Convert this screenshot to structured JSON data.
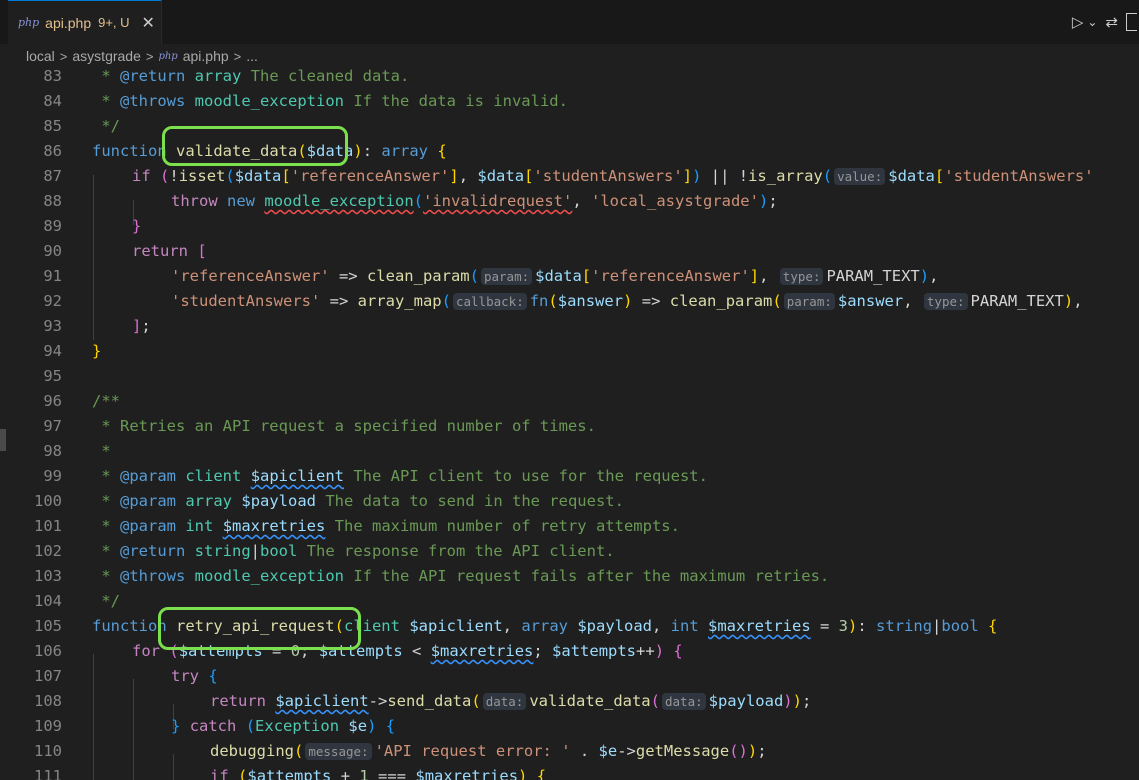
{
  "tab": {
    "lang_icon": "php",
    "filename": "api.php",
    "status": "9+, U",
    "close_glyph": "✕"
  },
  "actions": [
    {
      "name": "run-icon",
      "glyph": "▷"
    },
    {
      "name": "chevron-down-icon",
      "glyph": "⌄"
    },
    {
      "name": "source-control-compare-icon",
      "glyph": "⇄"
    }
  ],
  "breadcrumb": {
    "items": [
      "local",
      "asystgrade",
      "api.php",
      "..."
    ],
    "separator": ">",
    "php_icon": "php"
  },
  "editor": {
    "lines": [
      {
        "n": "83"
      },
      {
        "n": "84"
      },
      {
        "n": "85"
      },
      {
        "n": "86"
      },
      {
        "n": "87"
      },
      {
        "n": "88"
      },
      {
        "n": "89"
      },
      {
        "n": "90"
      },
      {
        "n": "91"
      },
      {
        "n": "92"
      },
      {
        "n": "93"
      },
      {
        "n": "94"
      },
      {
        "n": "95"
      },
      {
        "n": "96"
      },
      {
        "n": "97"
      },
      {
        "n": "98"
      },
      {
        "n": "99"
      },
      {
        "n": "100"
      },
      {
        "n": "101"
      },
      {
        "n": "102"
      },
      {
        "n": "103"
      },
      {
        "n": "104"
      },
      {
        "n": "105"
      },
      {
        "n": "106"
      },
      {
        "n": "107"
      },
      {
        "n": "108"
      },
      {
        "n": "109"
      },
      {
        "n": "110"
      },
      {
        "n": "111"
      }
    ],
    "t": {
      "star": " * ",
      "ret_tag": "@return",
      "array": "array",
      "cleaned": " The cleaned data.",
      "throws_tag": "@throws",
      "moodle_exc": "moodle_exception",
      "if_invalid": " If the data is invalid.",
      "end_doc": " */",
      "function": "function",
      "validate_data": "validate_data",
      "open_paren": "(",
      "data_var": "$data",
      "close_paren_colon": "): ",
      "brace_open": "{",
      "if": "if",
      "isset": "isset",
      "br_sq_open": "[",
      "ref_key_q": "'referenceAnswer'",
      "br_sq_close": "]",
      "comma_sp": ", ",
      "stud_key_q": "'studentAnswers'",
      "or_not": " || !",
      "is_array": "is_array",
      "hint_value": "value:",
      "throw": "throw",
      "new": "new",
      "invalidrequest_q": "'invalidrequest'",
      "plugin_q": "'local_asystgrade'",
      "close_semi": ");",
      "brace_close": "}",
      "return": "return",
      "arrow": " => ",
      "clean_param": "clean_param",
      "hint_param": "param:",
      "hint_type": "type:",
      "param_text": "PARAM_TEXT",
      "array_map": "array_map",
      "hint_callback": "callback:",
      "fn": "fn",
      "answer_var": "$answer",
      "close_sq_semi": "];",
      "doc_open": "/**",
      "retries_desc": " Retries an API request a specified number of times.",
      "param_tag": "@param",
      "client": "client",
      "apiclient_var": "$apiclient",
      "client_desc": " The API client to use for the request.",
      "payload_var": "$payload",
      "payload_desc": " The data to send in the request.",
      "int": "int",
      "maxretries_var": "$maxretries",
      "maxretries_desc": " The maximum number of retry attempts.",
      "string": "string",
      "pipe": "|",
      "bool": "bool",
      "response_desc": " The response from the API client.",
      "fails_desc": " If the API request fails after the maximum retries.",
      "retry_api_request": "retry_api_request",
      "client_kw": "client",
      "eq3": " = ",
      "three": "3",
      "for": "for",
      "attempts_var": "$attempts",
      "zero": "0",
      "lt": " < ",
      "pp": "++",
      "semi_sp": "; ",
      "try": "try",
      "arrow_obj": "->",
      "send_data": "send_data",
      "hint_data": "data:",
      "catch": "catch",
      "exception": "Exception",
      "e_var": "$e",
      "debugging": "debugging",
      "hint_message": "message:",
      "err_str": "'API request error: '",
      "dot": " . ",
      "getmessage": "getMessage",
      "plus1": " + ",
      "one": "1",
      "eqeq": " === "
    }
  }
}
